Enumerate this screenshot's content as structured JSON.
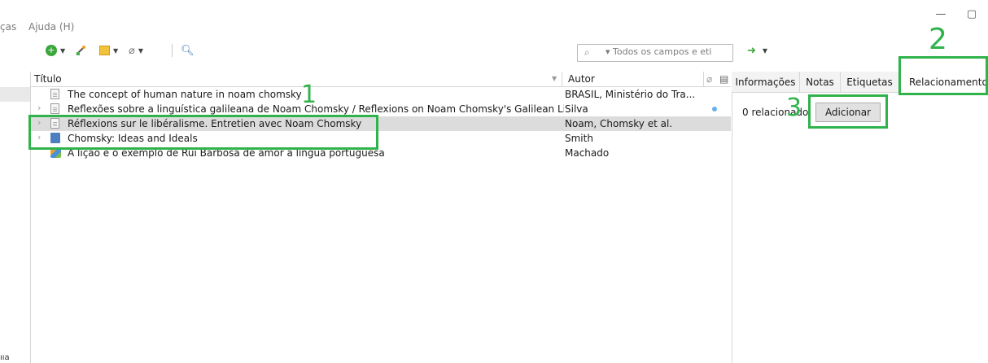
{
  "window": {
    "minimize_glyph": "—",
    "restore_glyph": "▢"
  },
  "menu": {
    "partial_left": "ças",
    "ajuda": "Ajuda (H)"
  },
  "toolbar": {
    "new_item_icon": "plus-circle-icon",
    "magic_wand_icon": "magic-wand-icon",
    "add_attachment_icon": "note-icon",
    "link_icon": "paperclip-icon",
    "search_icon": "magnifier-icon",
    "sync_icon": "green-arrow-icon"
  },
  "search": {
    "placeholder": "▾ Todos os campos e eti"
  },
  "list": {
    "headers": {
      "title": "Título",
      "author": "Autor"
    },
    "rows": [
      {
        "title": "The concept of human nature in noam chomsky",
        "author": "BRASIL, Ministério do Tra...",
        "icon": "document-icon",
        "expandable": false,
        "selected": false
      },
      {
        "title": "Reflexões sobre a linguística galileana de Noam Chomsky / Reflexions on Noam Chomsky's Galilean Lin...",
        "author": "Silva",
        "icon": "document-icon",
        "expandable": true,
        "selected": false
      },
      {
        "title": "Réflexions sur le libéralisme. Entretien avec Noam Chomsky",
        "author": "Noam, Chomsky et al.",
        "icon": "document-icon",
        "expandable": true,
        "selected": true
      },
      {
        "title": "Chomsky: Ideas and Ideals",
        "author": "Smith",
        "icon": "book-icon",
        "expandable": true,
        "selected": false
      },
      {
        "title": "A lição e o exemplo de Rui Barbosa de amor à língua portuguesa",
        "author": "Machado",
        "icon": "webpage-icon",
        "expandable": false,
        "selected": false
      }
    ]
  },
  "tabs": [
    "Informações",
    "Notas",
    "Etiquetas",
    "Relacionamento"
  ],
  "related": {
    "count_label": "0 relacionado:",
    "add_button": "Adicionar"
  },
  "annotations": {
    "one": "1",
    "two": "2",
    "three": "3",
    "color": "#2fb34a"
  },
  "bottom": {
    "glyph": "ııa"
  }
}
